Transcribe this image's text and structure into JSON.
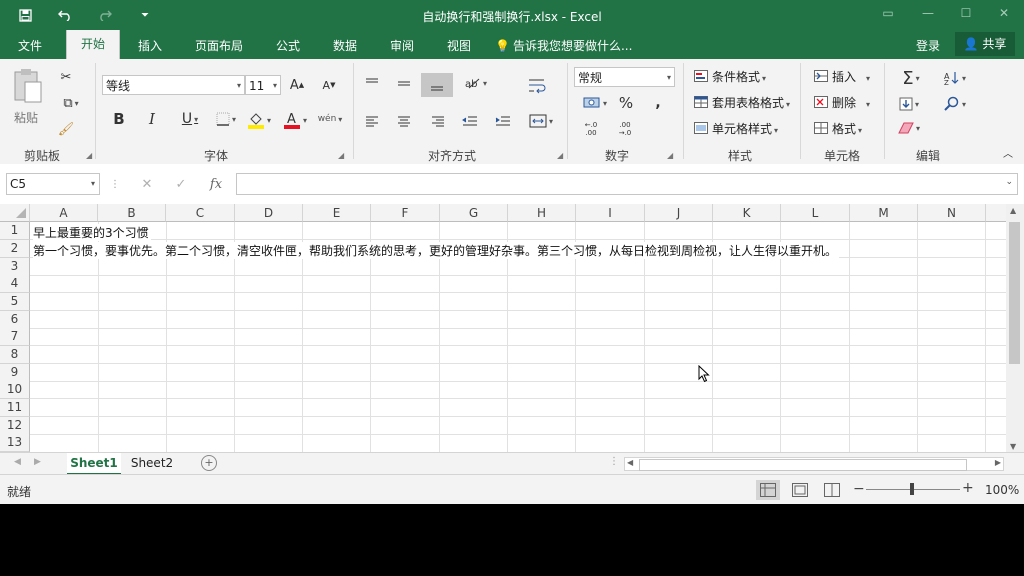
{
  "window": {
    "title": "自动换行和强制换行.xlsx - Excel"
  },
  "qat": {
    "save": "save-icon",
    "undo": "undo-icon",
    "redo": "redo-icon",
    "customize": "customize-icon"
  },
  "menu": {
    "tabs": [
      "文件",
      "开始",
      "插入",
      "页面布局",
      "公式",
      "数据",
      "审阅",
      "视图"
    ],
    "tell_me": "告诉我您想要做什么...",
    "signin": "登录",
    "share": "共享"
  },
  "ribbon": {
    "clipboard": {
      "label": "剪贴板",
      "paste": "粘贴"
    },
    "font": {
      "label": "字体",
      "name": "等线",
      "size": "11"
    },
    "alignment": {
      "label": "对齐方式"
    },
    "number": {
      "label": "数字",
      "format": "常规"
    },
    "styles": {
      "label": "样式",
      "conditional": "条件格式",
      "table": "套用表格格式",
      "cell": "单元格样式"
    },
    "cells": {
      "label": "单元格",
      "insert": "插入",
      "delete": "删除",
      "format": "格式"
    },
    "editing": {
      "label": "编辑"
    }
  },
  "formula_bar": {
    "name_box": "C5",
    "formula": ""
  },
  "grid": {
    "columns": [
      "A",
      "B",
      "C",
      "D",
      "E",
      "F",
      "G",
      "H",
      "I",
      "J",
      "K",
      "L",
      "M",
      "N"
    ],
    "rows": [
      "1",
      "2",
      "3",
      "4",
      "5",
      "6",
      "7",
      "8",
      "9",
      "10",
      "11",
      "12",
      "13"
    ],
    "a1": "早上最重要的3个习惯",
    "a2": "第一个习惯，要事优先。第二个习惯，清空收件匣，帮助我们系统的思考，更好的管理好杂事。第三个习惯，从每日检视到周检视，让人生得以重开机。"
  },
  "sheets": [
    "Sheet1",
    "Sheet2"
  ],
  "status": {
    "ready": "就绪",
    "zoom": "100%"
  },
  "colors": {
    "brand": "#217346",
    "ribbon_bg": "#f3f3f3"
  }
}
